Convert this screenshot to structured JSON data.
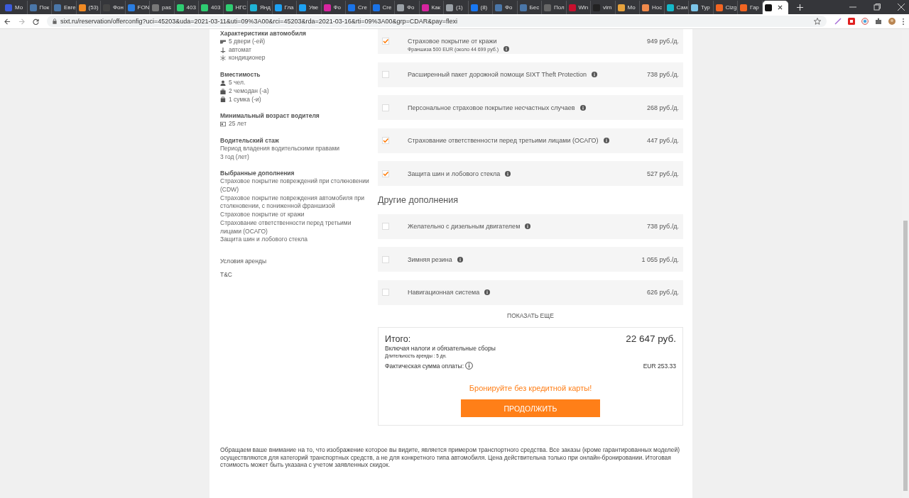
{
  "browser": {
    "tabs": [
      {
        "title": "Мо",
        "color": "#3b5bdb",
        "selected": false
      },
      {
        "title": "Пок",
        "color": "#4a76a8",
        "selected": false
      },
      {
        "title": "Евге",
        "color": "#4a76a8",
        "selected": false
      },
      {
        "title": "(53)",
        "color": "#f08a24",
        "selected": false
      },
      {
        "title": "Фон",
        "color": "#444444",
        "selected": false
      },
      {
        "title": "FON",
        "color": "#2a7de1",
        "selected": false
      },
      {
        "title": "pas",
        "color": "#777777",
        "selected": false
      },
      {
        "title": "403",
        "color": "#2ecc71",
        "selected": false
      },
      {
        "title": "403",
        "color": "#2ecc71",
        "selected": false
      },
      {
        "title": "НГС",
        "color": "#2ecc71",
        "selected": false
      },
      {
        "title": "Янд",
        "color": "#1fb4d6",
        "selected": false
      },
      {
        "title": "Гла",
        "color": "#1da1f2",
        "selected": false
      },
      {
        "title": "Уве",
        "color": "#1da1f2",
        "selected": false
      },
      {
        "title": "Фо",
        "color": "#d6249f",
        "selected": false
      },
      {
        "title": "Cre",
        "color": "#1a73e8",
        "selected": false
      },
      {
        "title": "Cre",
        "color": "#1a73e8",
        "selected": false
      },
      {
        "title": "Фо",
        "color": "#9aa0a6",
        "selected": false
      },
      {
        "title": "Как",
        "color": "#d6249f",
        "selected": false
      },
      {
        "title": "(1)",
        "color": "#9aa0a6",
        "selected": false
      },
      {
        "title": "(8)",
        "color": "#1877f2",
        "selected": false
      },
      {
        "title": "Фо",
        "color": "#4a76a8",
        "selected": false
      },
      {
        "title": "Бес",
        "color": "#4a76a8",
        "selected": false
      },
      {
        "title": "Пол",
        "color": "#666666",
        "selected": false
      },
      {
        "title": "Win",
        "color": "#c8102e",
        "selected": false
      },
      {
        "title": "vim",
        "color": "#222222",
        "selected": false
      },
      {
        "title": "Мо",
        "color": "#e6a23c",
        "selected": false
      },
      {
        "title": "Нос",
        "color": "#f08a4b",
        "selected": false
      },
      {
        "title": "Сам",
        "color": "#14b8c8",
        "selected": false
      },
      {
        "title": "Тур",
        "color": "#7cc4e8",
        "selected": false
      },
      {
        "title": "Cizg",
        "color": "#f26522",
        "selected": false
      },
      {
        "title": "Гар",
        "color": "#f26522",
        "selected": false
      },
      {
        "color": "#111111",
        "selected": true
      }
    ],
    "url": "sixt.ru/reservation/offerconfig?uci=45203&uda=2021-03-11&uti=09%3A00&rci=45203&rda=2021-03-16&rti=09%3A00&grp=CDAR&pay=flexi"
  },
  "sidebar": {
    "sections": [
      {
        "heading": "Характеристики автомобиля",
        "items": [
          {
            "kind": "door",
            "text": "5 двери (-ей)"
          },
          {
            "kind": "gear",
            "text": "автомат"
          },
          {
            "kind": "snow",
            "text": "кондиционер"
          }
        ]
      },
      {
        "heading": "Вместимость",
        "items": [
          {
            "kind": "person",
            "text": "5 чел."
          },
          {
            "kind": "suitcase",
            "text": "2 чемодан (-а)"
          },
          {
            "kind": "bag",
            "text": "1 сумка (-и)"
          }
        ]
      },
      {
        "heading": "Минимальный возраст водителя",
        "items": [
          {
            "kind": "card",
            "text": "25 лет"
          }
        ]
      },
      {
        "heading": "Водительский стаж",
        "items": [
          {
            "kind": "plain",
            "text": "Период владения водительскими правами"
          },
          {
            "kind": "plain",
            "text": "3 год (лет)"
          }
        ]
      },
      {
        "heading": "Выбранные дополнения",
        "items": [
          {
            "kind": "plain",
            "text": "Страховое покрытие повреждений при столкновении (CDW)"
          },
          {
            "kind": "plain",
            "text": "Страховое покрытие повреждения автомобиля при столкновении, с пониженной франшизой"
          },
          {
            "kind": "plain",
            "text": "Страховое покрытие от кражи"
          },
          {
            "kind": "plain",
            "text": "Страхование ответственности перед третьими лицами (ОСАГО)"
          },
          {
            "kind": "plain",
            "text": "Защита шин и лобового стекла"
          }
        ]
      }
    ],
    "links": [
      "Условия аренды",
      "T&C"
    ]
  },
  "extras": [
    {
      "title": "Страховое покрытие от кражи",
      "note": "Франшиза 500 EUR (около 44 699 руб.)",
      "price": "949 руб./д.",
      "checked": true
    },
    {
      "title": "Расширенный пакет дорожной помощи SIXT Theft Protection",
      "price": "738 руб./д.",
      "checked": false
    },
    {
      "title": "Персональное страховое покрытие несчастных случаев",
      "price": "268 руб./д.",
      "checked": false
    },
    {
      "title": "Страхование ответственности перед третьими лицами (ОСАГО)",
      "price": "447 руб./д.",
      "checked": true
    },
    {
      "title": "Защита шин и лобового стекла",
      "price": "527 руб./д.",
      "checked": true
    }
  ],
  "other_extras": {
    "heading": "Другие дополнения",
    "items": [
      {
        "title": "Желательно с дизельным двигателем",
        "price": "738 руб./д.",
        "checked": false
      },
      {
        "title": "Зимняя резина",
        "price": "1 055 руб./д.",
        "checked": false
      },
      {
        "title": "Навигационная система",
        "price": "626 руб./д.",
        "checked": false
      }
    ],
    "show_more": "ПОКАЗАТЬ ЕЩЕ"
  },
  "summary": {
    "total_label": "Итого:",
    "total": "22 647 руб.",
    "taxes_note": "Включая налоги и обязательные сборы",
    "duration": "Длительность аренды : 5 дн.",
    "actual_label": "Фактическая сумма оплаты:",
    "actual_value": "EUR 253.33",
    "promo": "Бронируйте без кредитной карты!",
    "button": "ПРОДОЛЖИТЬ"
  },
  "disclaimer": "Обращаем ваше внимание на то, что изображение которое вы видите, является примером транспортного средства. Все заказы (кроме гарантированных моделей) осуществляются для категорий транспортных средств, а не для конкретного типа автомобиля. Цена действительна только при онлайн-бронировании. Итоговая стоимость может быть указана с учетом заявленных скидок."
}
